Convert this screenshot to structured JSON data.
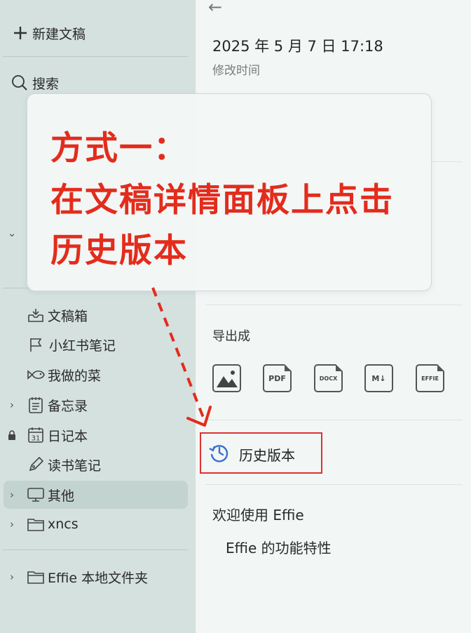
{
  "sidebar": {
    "new_doc": "新建文稿",
    "search": "搜索",
    "items": [
      {
        "label": "文稿箱"
      },
      {
        "label": "小红书笔记"
      },
      {
        "label": "我做的菜"
      },
      {
        "label": "备忘录"
      },
      {
        "label": "日记本",
        "calendar_day": "31"
      },
      {
        "label": "读书笔记"
      },
      {
        "label": "其他"
      },
      {
        "label": "xncs"
      }
    ],
    "local_folder": "Effie 本地文件夹"
  },
  "details": {
    "modified_time": "2025 年 5 月 7 日 17:18",
    "modified_label": "修改时间",
    "export_title": "导出成",
    "export_formats": [
      "PDF",
      "DOCX",
      "M↓",
      "EFFIE"
    ],
    "history_label": "历史版本",
    "doc_title": "欢迎使用 Effie",
    "doc_subtitle": "Effie 的功能特性"
  },
  "callout": {
    "line1": "方式一：",
    "line2": "在文稿详情面板上点击",
    "line3": "历史版本"
  },
  "colors": {
    "sidebar_bg": "#d4e1df",
    "main_bg": "#f2f6f5",
    "accent_red": "#e32c1c",
    "history_blue": "#3b6fd0"
  }
}
